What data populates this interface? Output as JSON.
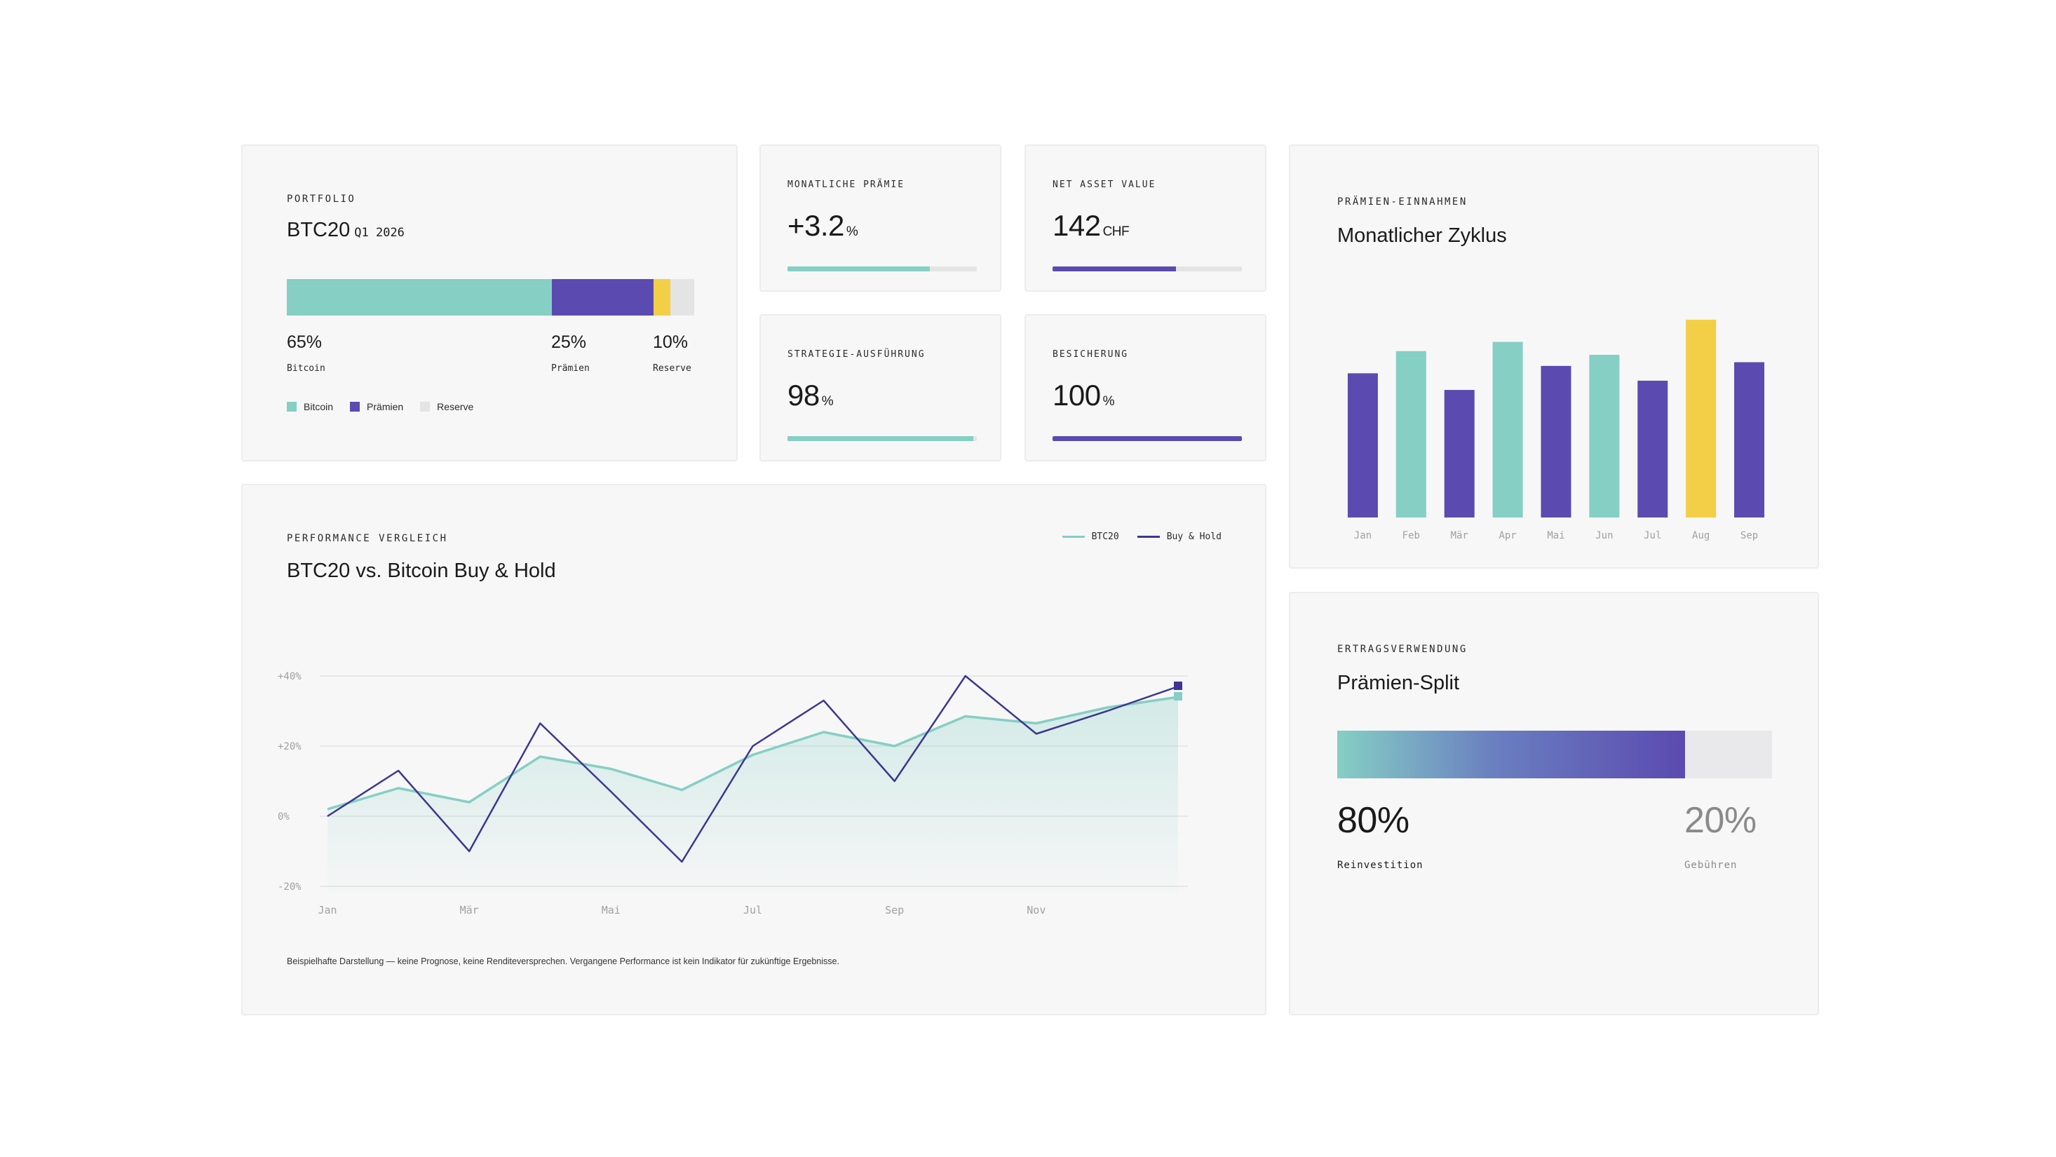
{
  "colors": {
    "teal": "#85cfc4",
    "purple": "#5b4ab0",
    "navy": "#3d3690",
    "yellow": "#f2cf46",
    "gray": "#e4e4e4",
    "card_bg": "#f7f7f7"
  },
  "portfolio": {
    "eyebrow": "PORTFOLIO",
    "title": "BTC20",
    "title_suffix": "Q1 2026",
    "segments": [
      {
        "pct": "65%",
        "label": "Bitcoin",
        "value": 65,
        "color": "#85cfc4"
      },
      {
        "pct": "25%",
        "label": "Prämien",
        "value": 25,
        "color": "#5b4ab0"
      },
      {
        "pct": "10%",
        "label": "Reserve",
        "value": 10
      }
    ],
    "legend": [
      "Bitcoin",
      "Prämien",
      "Reserve"
    ]
  },
  "kpis": {
    "monthly_premium": {
      "label": "MONATLICHE PRÄMIE",
      "value": "+3.2",
      "unit": "%",
      "progress": 0.75,
      "color": "#85cfc4"
    },
    "nav": {
      "label": "NET ASSET VALUE",
      "value": "142",
      "unit": "CHF",
      "progress": 0.65,
      "color": "#5b4ab0"
    },
    "strategy": {
      "label": "STRATEGIE-AUSFÜHRUNG",
      "value": "98",
      "unit": "%",
      "progress": 0.98,
      "color": "#85cfc4"
    },
    "collateral": {
      "label": "BESICHERUNG",
      "value": "100",
      "unit": "%",
      "progress": 1.0,
      "color": "#5b4ab0"
    }
  },
  "premium_income": {
    "eyebrow": "PRÄMIEN-EINNAHMEN",
    "title": "Monatlicher Zyklus"
  },
  "performance": {
    "eyebrow": "PERFORMANCE VERGLEICH",
    "title": "BTC20 vs. Bitcoin Buy & Hold",
    "legend": [
      "BTC20",
      "Buy & Hold"
    ],
    "note": "Beispielhafte Darstellung — keine Prognose, keine Renditeversprechen. Vergangene Performance ist kein Indikator für zukünftige Ergebnisse."
  },
  "split": {
    "eyebrow": "ERTRAGSVERWENDUNG",
    "title": "Prämien-Split",
    "reinvest_pct": "80%",
    "reinvest_label": "Reinvestition",
    "reinvest_value": 80,
    "fees_pct": "20%",
    "fees_label": "Gebühren"
  },
  "chart_data": [
    {
      "type": "bar",
      "categories": [
        "Jan",
        "Feb",
        "Mär",
        "Apr",
        "Mai",
        "Jun",
        "Jul",
        "Aug",
        "Sep"
      ],
      "values": [
        3.9,
        4.5,
        3.45,
        4.75,
        4.1,
        4.4,
        3.7,
        5.35,
        4.2
      ],
      "bar_colors": [
        "#5b4ab0",
        "#85cfc4",
        "#5b4ab0",
        "#85cfc4",
        "#5b4ab0",
        "#85cfc4",
        "#5b4ab0",
        "#f2cf46",
        "#5b4ab0"
      ],
      "ylim": [
        0,
        5.5
      ]
    },
    {
      "type": "line",
      "x_ticks": [
        "Jan",
        "Mär",
        "Mai",
        "Jul",
        "Sep",
        "Nov"
      ],
      "y_ticks": [
        "+40%",
        "+20%",
        "0%",
        "-20%"
      ],
      "y_tick_values": [
        40,
        20,
        0,
        -20
      ],
      "ylim": [
        -20,
        40
      ],
      "series": [
        {
          "name": "BTC20",
          "color": "#85cfc4",
          "fill": true,
          "x": [
            0,
            1,
            2,
            3,
            4,
            5,
            6,
            7,
            8,
            9,
            10,
            11,
            12
          ],
          "values": [
            2,
            8,
            4,
            17,
            13.5,
            7.5,
            17.5,
            24,
            20,
            28.5,
            26.5,
            31,
            34
          ]
        },
        {
          "name": "Buy & Hold",
          "color": "#3d3690",
          "fill": false,
          "x": [
            0,
            1,
            2,
            3,
            4,
            5,
            6,
            7,
            8,
            9,
            10,
            11,
            12
          ],
          "values": [
            0,
            13,
            -10,
            26.5,
            7,
            -13,
            20,
            33,
            10,
            40,
            23.5,
            30,
            37
          ]
        }
      ]
    }
  ]
}
